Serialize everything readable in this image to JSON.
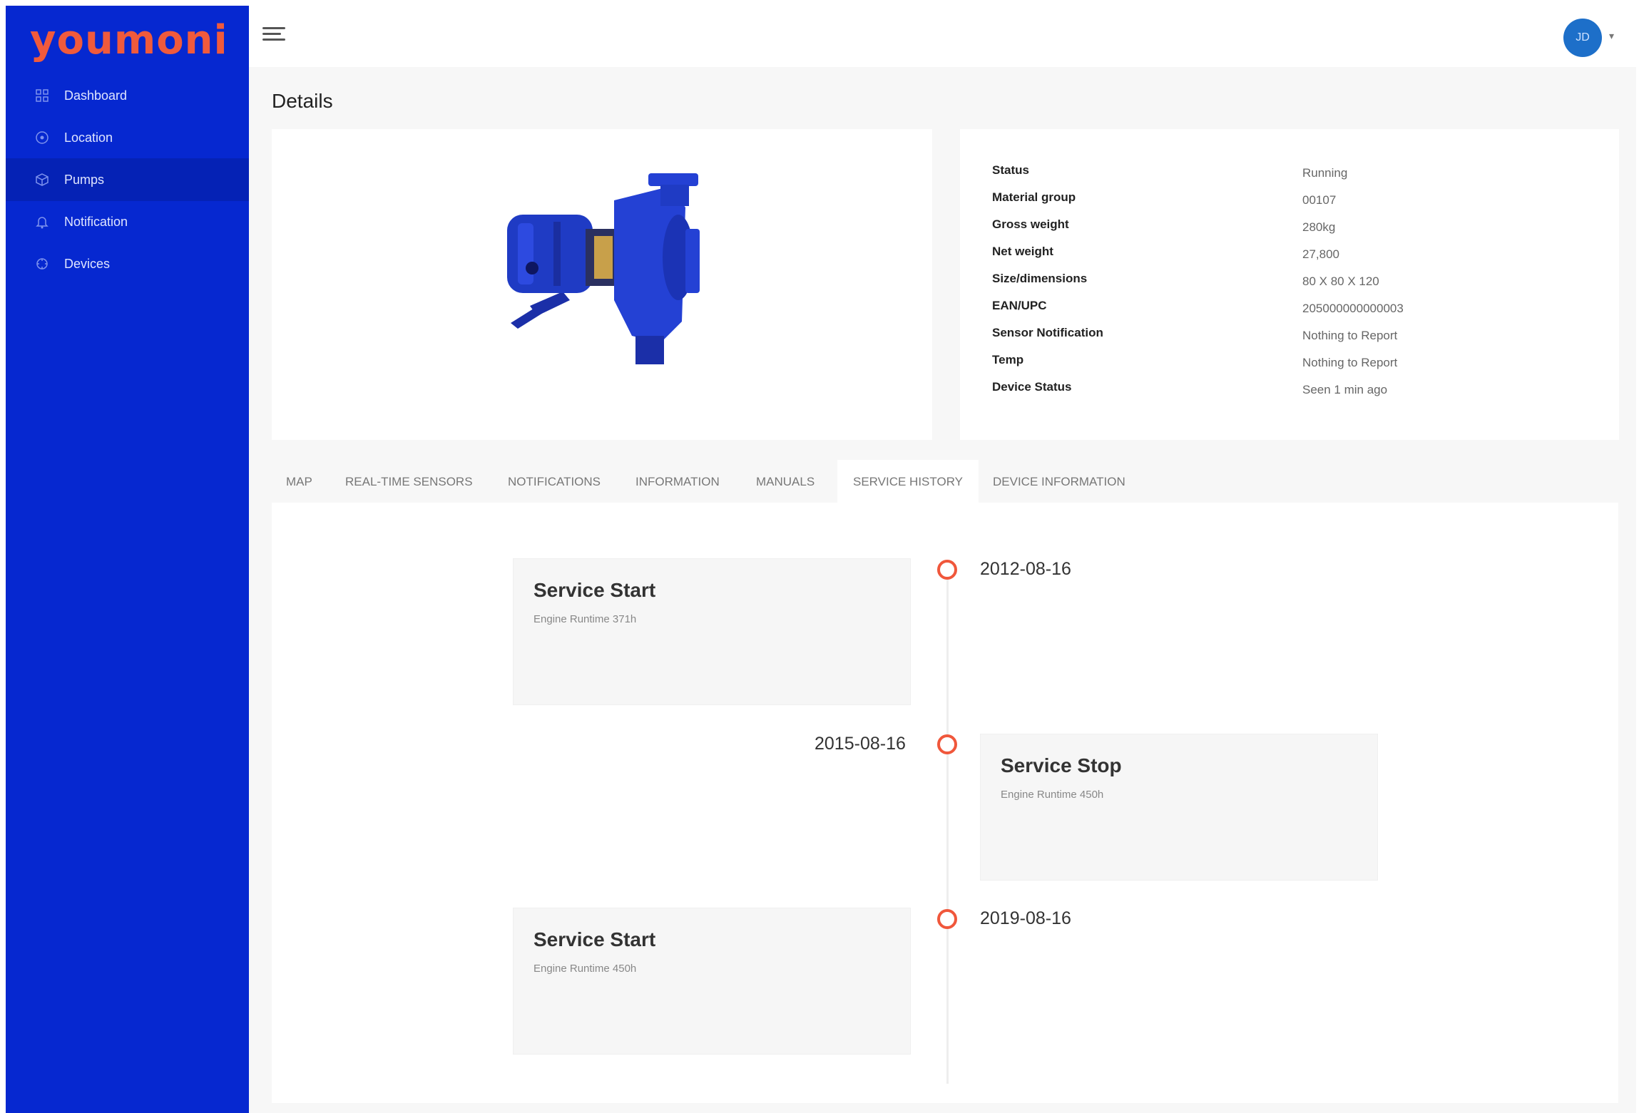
{
  "app": {
    "logo": "youmoni"
  },
  "sidebar": {
    "items": [
      {
        "label": "Dashboard",
        "icon": "dashboard-icon"
      },
      {
        "label": "Location",
        "icon": "location-icon"
      },
      {
        "label": "Pumps",
        "icon": "pump-icon",
        "active": true
      },
      {
        "label": "Notification",
        "icon": "bell-icon"
      },
      {
        "label": "Devices",
        "icon": "device-icon"
      }
    ]
  },
  "header": {
    "avatar_initials": "JD",
    "menu_icon": "hamburger-icon"
  },
  "page": {
    "title": "Details"
  },
  "specs": [
    {
      "key": "Status",
      "value": "Running"
    },
    {
      "key": "Material group",
      "value": "00107"
    },
    {
      "key": "Gross weight",
      "value": "280kg"
    },
    {
      "key": "Net weight",
      "value": "27,800"
    },
    {
      "key": "Size/dimensions",
      "value": "80 X 80 X 120"
    },
    {
      "key": "EAN/UPC",
      "value": "205000000000003"
    },
    {
      "key": "Sensor Notification",
      "value": "Nothing to Report"
    },
    {
      "key": "Temp",
      "value": "Nothing to Report"
    },
    {
      "key": "Device Status",
      "value": "Seen 1 min ago"
    }
  ],
  "tabs": [
    {
      "label": "MAP"
    },
    {
      "label": "REAL-TIME SENSORS"
    },
    {
      "label": "NOTIFICATIONS"
    },
    {
      "label": "INFORMATION"
    },
    {
      "label": "MANUALS"
    },
    {
      "label": "SERVICE HISTORY",
      "active": true
    },
    {
      "label": "DEVICE INFORMATION"
    }
  ],
  "timeline": [
    {
      "title": "Service Start",
      "subtitle": "Engine Runtime 371h",
      "date": "2012-08-16"
    },
    {
      "title": "Service Stop",
      "subtitle": "Engine Runtime 450h",
      "date": "2015-08-16"
    },
    {
      "title": "Service Start",
      "subtitle": "Engine Runtime 450h",
      "date": "2019-08-16"
    }
  ],
  "colors": {
    "sidebar": "#0628d0",
    "accent": "#f05a3c",
    "avatar": "#1d6fc9"
  }
}
